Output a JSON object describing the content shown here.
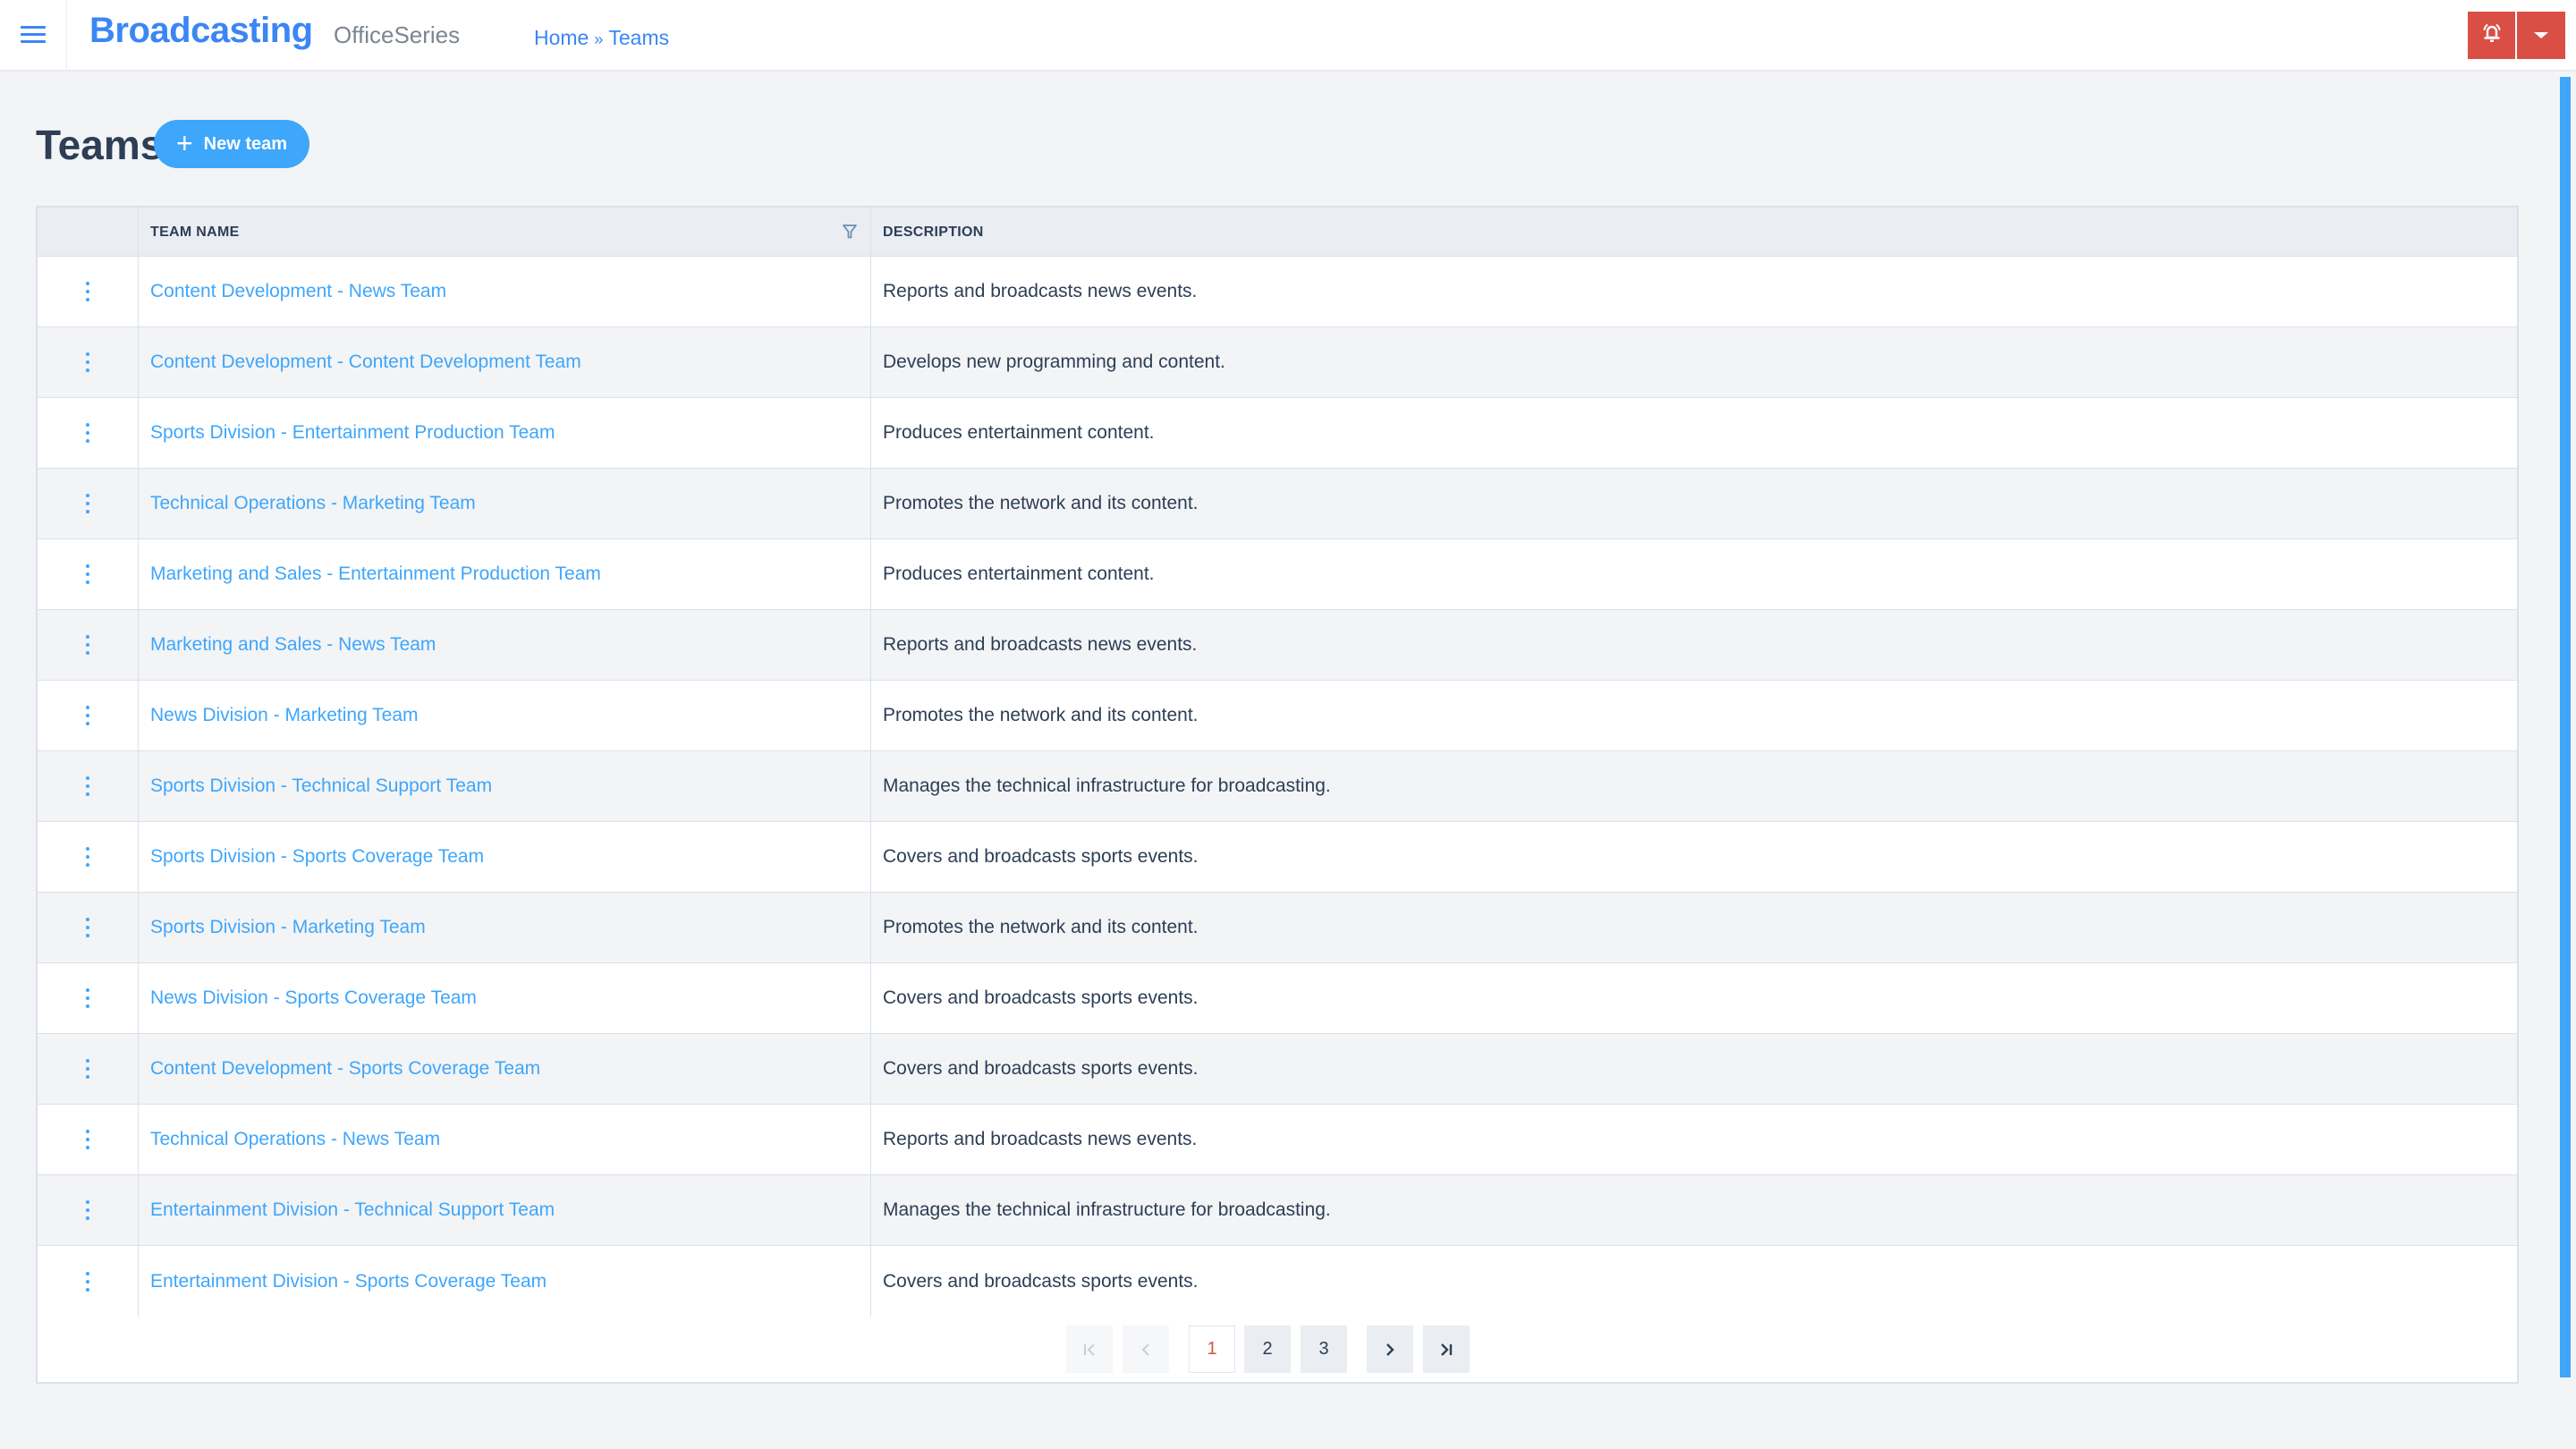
{
  "header": {
    "brand": "Broadcasting",
    "product": "OfficeSeries",
    "breadcrumb": {
      "home": "Home",
      "separator": "»",
      "current": "Teams"
    },
    "icons": {
      "menu": "hamburger-icon",
      "alert": "bell-alert-icon",
      "dropdown": "caret-down-icon"
    },
    "accent_color": "#3b86f5",
    "alert_color": "#d94f45"
  },
  "page": {
    "title": "Teams",
    "new_button_label": "New team",
    "new_button_icon": "plus-icon"
  },
  "table": {
    "columns": [
      "",
      "TEAM NAME",
      "DESCRIPTION"
    ],
    "filter_icon": "filter-icon",
    "row_menu_icon": "kebab-menu-icon",
    "rows": [
      {
        "name": "Content Development - News Team",
        "description": "Reports and broadcasts news events."
      },
      {
        "name": "Content Development - Content Development Team",
        "description": "Develops new programming and content."
      },
      {
        "name": "Sports Division - Entertainment Production Team",
        "description": "Produces entertainment content."
      },
      {
        "name": "Technical Operations - Marketing Team",
        "description": "Promotes the network and its content."
      },
      {
        "name": "Marketing and Sales - Entertainment Production Team",
        "description": "Produces entertainment content."
      },
      {
        "name": "Marketing and Sales - News Team",
        "description": "Reports and broadcasts news events."
      },
      {
        "name": "News Division - Marketing Team",
        "description": "Promotes the network and its content."
      },
      {
        "name": "Sports Division - Technical Support Team",
        "description": "Manages the technical infrastructure for broadcasting."
      },
      {
        "name": "Sports Division - Sports Coverage Team",
        "description": "Covers and broadcasts sports events."
      },
      {
        "name": "Sports Division - Marketing Team",
        "description": "Promotes the network and its content."
      },
      {
        "name": "News Division - Sports Coverage Team",
        "description": "Covers and broadcasts sports events."
      },
      {
        "name": "Content Development - Sports Coverage Team",
        "description": "Covers and broadcasts sports events."
      },
      {
        "name": "Technical Operations - News Team",
        "description": "Reports and broadcasts news events."
      },
      {
        "name": "Entertainment Division - Technical Support Team",
        "description": "Manages the technical infrastructure for broadcasting."
      },
      {
        "name": "Entertainment Division - Sports Coverage Team",
        "description": "Covers and broadcasts sports events."
      }
    ]
  },
  "pagination": {
    "first": "|<",
    "prev": "<",
    "pages": [
      "1",
      "2",
      "3"
    ],
    "current_page": "1",
    "next": ">",
    "last": ">|"
  }
}
